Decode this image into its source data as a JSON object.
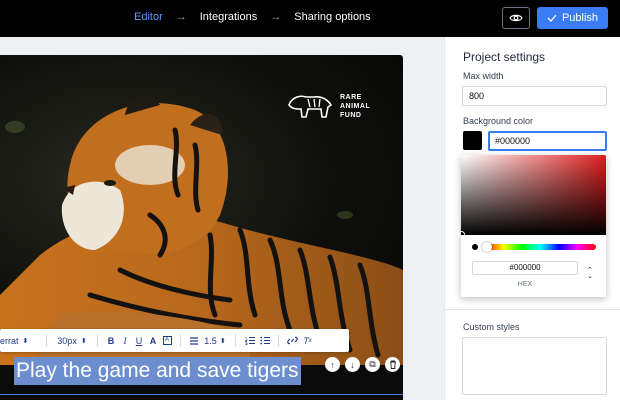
{
  "nav": {
    "steps": [
      "Editor",
      "Integrations",
      "Sharing options"
    ],
    "arrow": "→",
    "publish_label": "Publish"
  },
  "canvas": {
    "headline": "Play the game and save tigers",
    "logo_lines": [
      "RARE",
      "ANIMAL",
      "FUND"
    ],
    "toolbar": {
      "font": "errat",
      "size": "30px",
      "line_height": "1.5"
    }
  },
  "panel": {
    "title": "Project settings",
    "max_width_label": "Max width",
    "max_width_value": "800",
    "bg_color_label": "Background color",
    "bg_color_value": "#000000",
    "custom_styles_label": "Custom styles"
  },
  "picker": {
    "hex_value": "#000000",
    "mode_label": "HEX"
  },
  "colors": {
    "accent": "#3b7cf5",
    "active_step": "#5b9bff",
    "topbar": "#000000"
  }
}
